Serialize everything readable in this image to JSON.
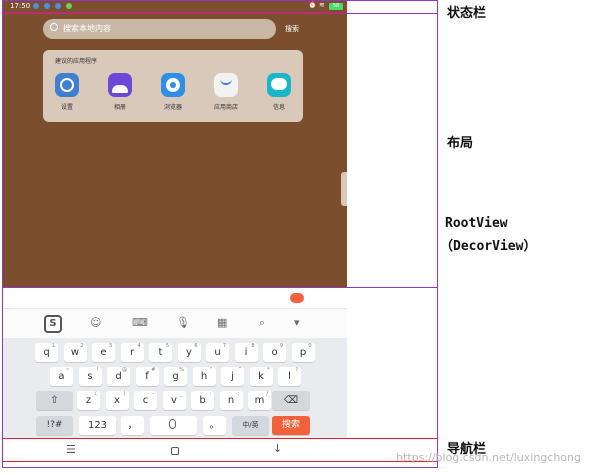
{
  "labels": {
    "statusbar": "状态栏",
    "layout": "布局",
    "rootview": "RootView",
    "decorview": "（DecorView）",
    "navbar": "导航栏"
  },
  "status": {
    "time": "17:50",
    "battery": "58"
  },
  "search": {
    "placeholder": "搜索本地内容",
    "button": "搜索"
  },
  "suggest": {
    "title": "建议的应用程序",
    "apps": [
      {
        "label": "设置",
        "icon": "settings-icon",
        "color": "#3f7fd1"
      },
      {
        "label": "相册",
        "icon": "gallery-icon",
        "color": "#6a49d8"
      },
      {
        "label": "浏览器",
        "icon": "browser-icon",
        "color": "#2f8ee6"
      },
      {
        "label": "应用商店",
        "icon": "appstore-icon",
        "color": "#f2f2f2"
      },
      {
        "label": "信息",
        "icon": "message-icon",
        "color": "#19b6c9"
      }
    ]
  },
  "keyboard": {
    "row1": [
      {
        "k": "q",
        "s": "1"
      },
      {
        "k": "w",
        "s": "2"
      },
      {
        "k": "e",
        "s": "3"
      },
      {
        "k": "r",
        "s": "4"
      },
      {
        "k": "t",
        "s": "5"
      },
      {
        "k": "y",
        "s": "6"
      },
      {
        "k": "u",
        "s": "7"
      },
      {
        "k": "i",
        "s": "8"
      },
      {
        "k": "o",
        "s": "9"
      },
      {
        "k": "p",
        "s": "0"
      }
    ],
    "row2": [
      {
        "k": "a",
        "s": "~"
      },
      {
        "k": "s",
        "s": "!"
      },
      {
        "k": "d",
        "s": "@"
      },
      {
        "k": "f",
        "s": "#"
      },
      {
        "k": "g",
        "s": "%"
      },
      {
        "k": "h",
        "s": "“"
      },
      {
        "k": "j",
        "s": "”"
      },
      {
        "k": "k",
        "s": "*"
      },
      {
        "k": "l",
        "s": "?"
      }
    ],
    "row3": [
      {
        "k": "z",
        "s": "("
      },
      {
        "k": "x",
        "s": ")"
      },
      {
        "k": "c",
        "s": "-"
      },
      {
        "k": "v",
        "s": "_"
      },
      {
        "k": "b",
        "s": ":"
      },
      {
        "k": "n",
        "s": ";"
      },
      {
        "k": "m",
        "s": "/"
      }
    ],
    "sym": "!?#",
    "num": "123",
    "comma": "，",
    "period": "。",
    "lang": "中/英",
    "enter": "搜索"
  },
  "watermark": "https://blog.csdn.net/luxingchong"
}
